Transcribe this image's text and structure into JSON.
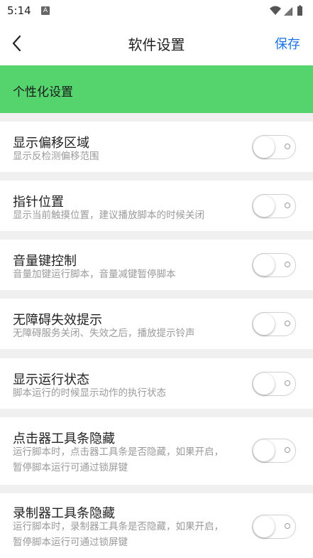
{
  "status_bar": {
    "time": "5:14",
    "notification_badge": "A"
  },
  "app_bar": {
    "title": "软件设置",
    "save_label": "保存"
  },
  "section": {
    "title": "个性化设置",
    "color": "#55d36c"
  },
  "settings": [
    {
      "title": "显示偏移区域",
      "desc": "显示反检测偏移范围",
      "enabled": false
    },
    {
      "title": "指针位置",
      "desc": "显示当前触摸位置，建议播放脚本的时候关闭",
      "enabled": false
    },
    {
      "title": "音量键控制",
      "desc": "音量加键运行脚本，音量减键暂停脚本",
      "enabled": false
    },
    {
      "title": "无障碍失效提示",
      "desc": "无障碍服务关闭、失效之后，播放提示铃声",
      "enabled": false
    },
    {
      "title": "显示运行状态",
      "desc": "脚本运行的时候显示动作的执行状态",
      "enabled": false
    },
    {
      "title": "点击器工具条隐藏",
      "desc": "运行脚本时，点击器工具条是否隐藏，如果开启，暂停脚本运行可通过锁屏键",
      "enabled": false
    },
    {
      "title": "录制器工具条隐藏",
      "desc": "运行脚本时，录制器工具条是否隐藏，如果开启，暂停脚本运行可通过锁屏键",
      "enabled": false
    }
  ],
  "colors": {
    "accent": "#1a73e8",
    "background": "#f0f0f0"
  }
}
